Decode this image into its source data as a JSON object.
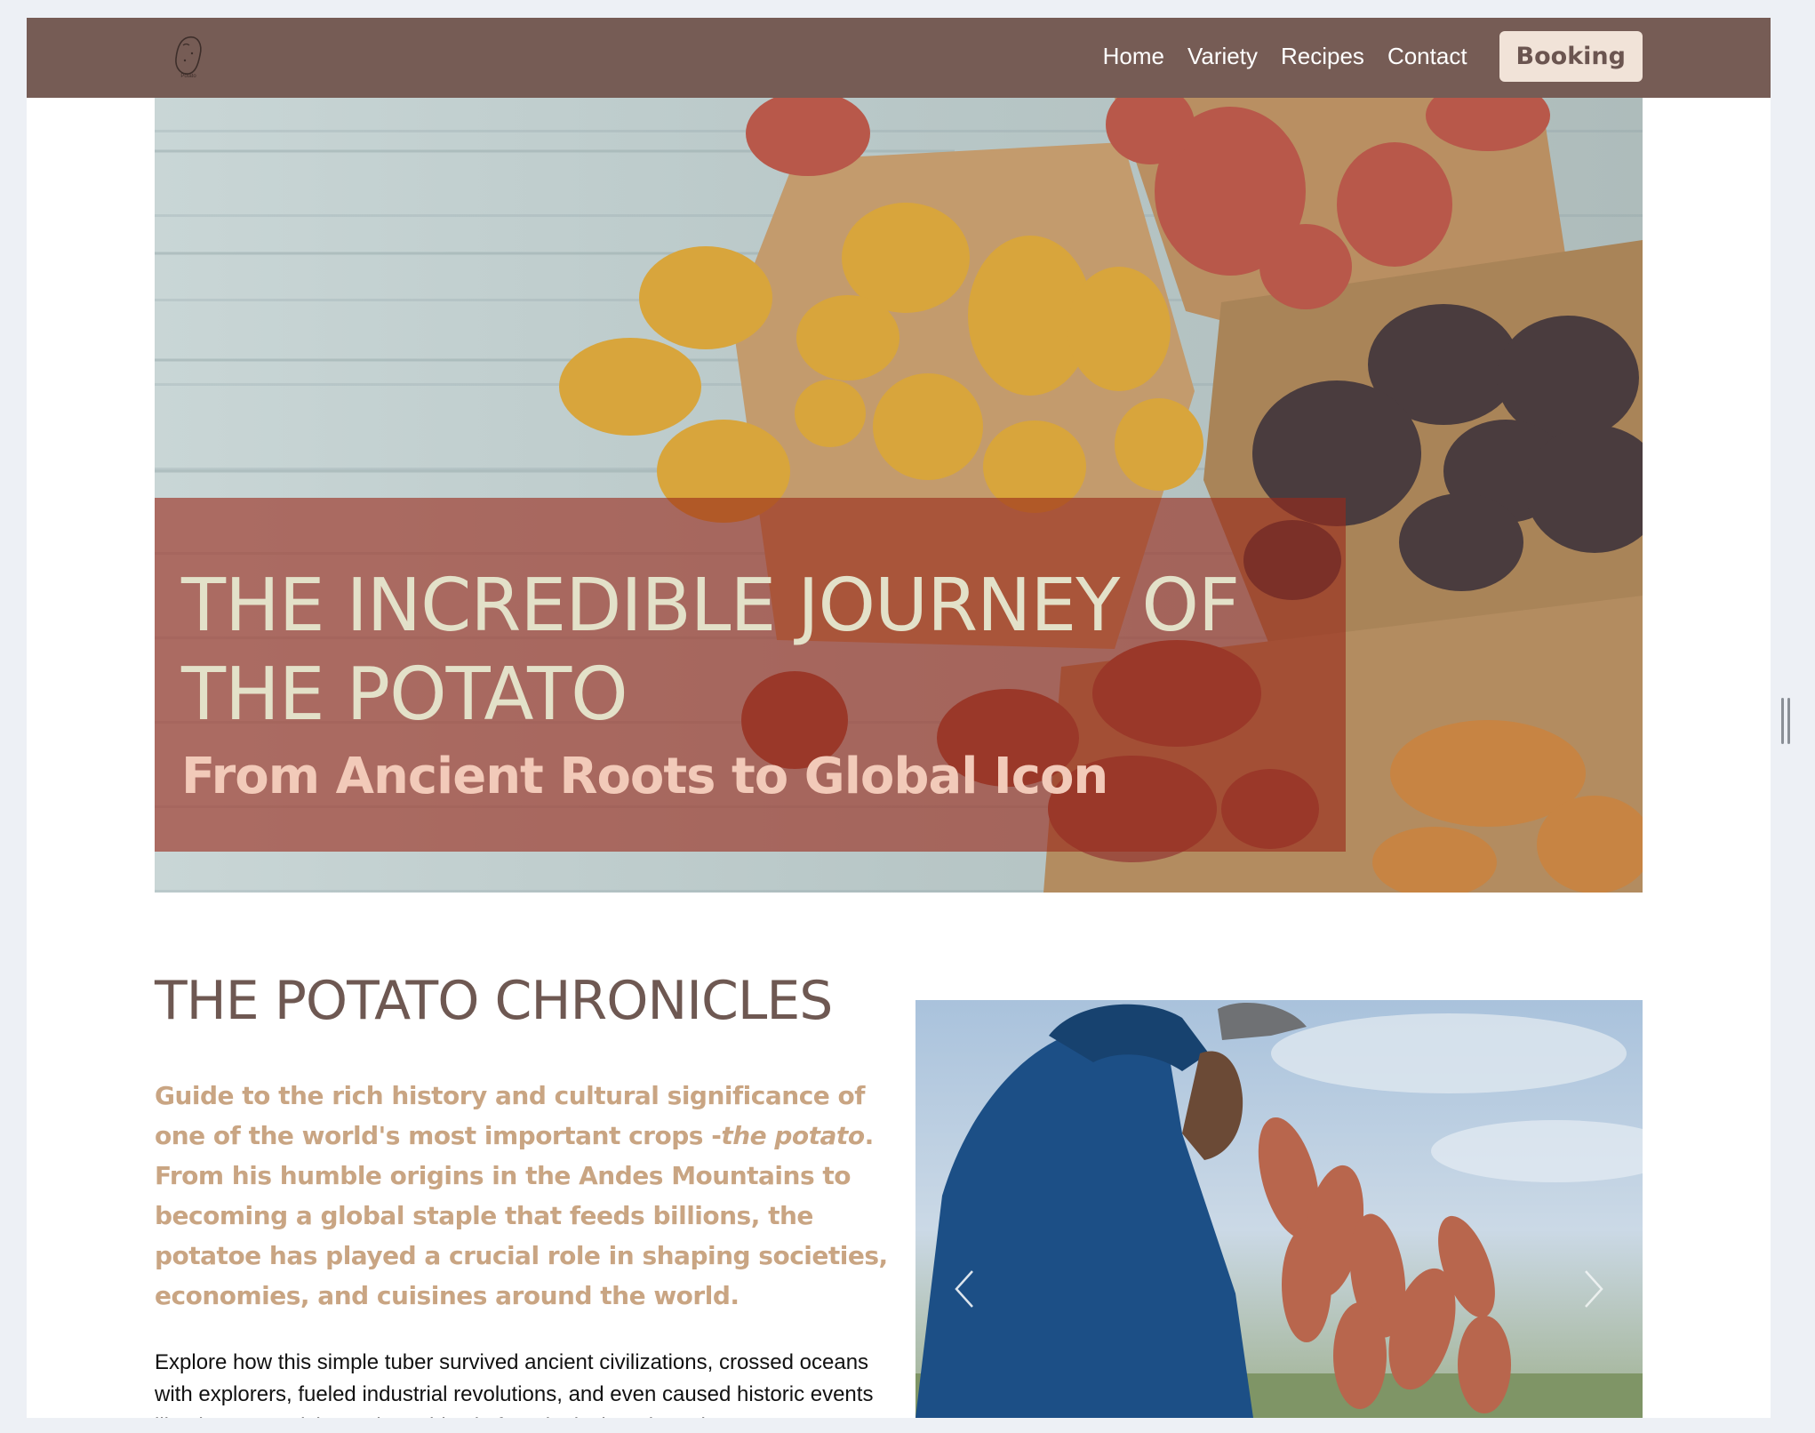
{
  "nav": {
    "logo_text": "Potato",
    "links": [
      "Home",
      "Variety",
      "Recipes",
      "Contact"
    ],
    "booking_label": "Booking"
  },
  "hero": {
    "title": "THE INCREDIBLE JOURNEY OF THE POTATO",
    "subtitle": "From Ancient Roots to Global Icon"
  },
  "chronicles": {
    "title": "THE POTATO CHRONICLES",
    "lead_part1": "Guide to the rich history and cultural significance of one of the world's most important crops -",
    "lead_emphasis": "the potato",
    "lead_part2": ". From his humble origins in the Andes Mountains to becoming a global staple that feeds billions, the potatoe has played a crucial role in shaping societies, economies, and cuisines around the world.",
    "body": "Explore how this simple tuber survived ancient civilizations, crossed oceans with explorers, fueled industrial revolutions, and even caused historic events like the Great Irish Famine. This platform is designed to take"
  },
  "colors": {
    "navbar": "#765c55",
    "booking_bg": "#f1e3d8",
    "overlay": "#9a2a1c",
    "hero_title": "#e3e1c9",
    "hero_subtitle": "#f2cab9",
    "section_title": "#6e5852",
    "lead": "#c9a583"
  },
  "icons": {
    "logo": "potato-logo-icon",
    "prev": "chevron-left-icon",
    "next": "chevron-right-icon"
  }
}
